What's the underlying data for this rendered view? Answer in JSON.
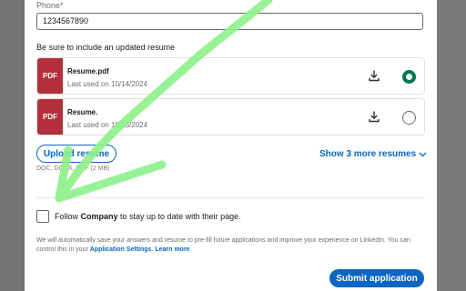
{
  "form": {
    "phone_label": "Phone*",
    "phone_value": "1234567890",
    "resume_hint": "Be sure to include an updated resume",
    "resumes": [
      {
        "badge": "PDF",
        "name": "Resume.pdf",
        "date": "Last used on 10/14/2024",
        "selected": true
      },
      {
        "badge": "PDF",
        "name": "Resume.",
        "date": "Last used on 10/13/2024",
        "selected": false
      }
    ],
    "upload_label": "Upload resume",
    "file_types": "DOC, DOCX, PDF (2 MB)",
    "show_more_label": "Show 3 more resumes",
    "follow": {
      "prefix": "Follow ",
      "company": "Company",
      "suffix": " to stay up to date with their page."
    },
    "disclaimer": {
      "text": "We will automatically save your answers and resume to pre-fill future applications and improve your experience on LinkedIn. You can control this in your ",
      "settings_link": "Application Settings",
      "learn_more": "Learn more"
    },
    "submit_label": "Submit application"
  },
  "colors": {
    "accent": "#0a66c2",
    "pdf_badge": "#b3303b",
    "selected_radio": "#01754f",
    "annotation_stroke": "#8ef08c"
  }
}
